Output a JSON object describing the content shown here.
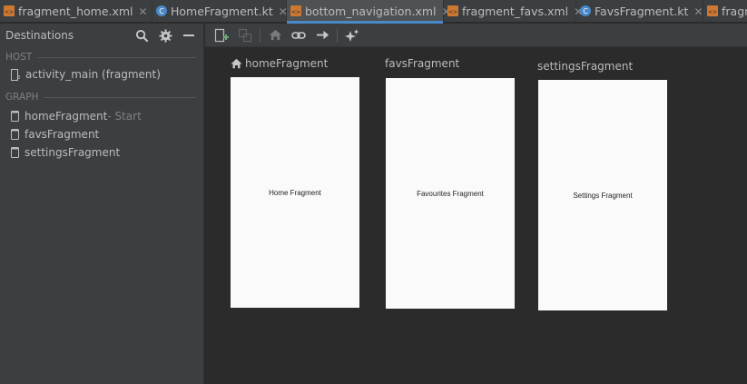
{
  "tabs": [
    {
      "label": "fragment_home.xml",
      "icon": "xml-file-icon",
      "active": false
    },
    {
      "label": "HomeFragment.kt",
      "icon": "kotlin-file-icon",
      "active": false
    },
    {
      "label": "bottom_navigation.xml",
      "icon": "xml-file-icon",
      "active": true
    },
    {
      "label": "fragment_favs.xml",
      "icon": "xml-file-icon",
      "active": false
    },
    {
      "label": "FavsFragment.kt",
      "icon": "kotlin-file-icon",
      "active": false
    },
    {
      "label": "fragn",
      "icon": "xml-file-icon",
      "active": false
    }
  ],
  "close_glyph": "✕",
  "sidebar": {
    "title": "Destinations",
    "host_section": "HOST",
    "host_item": "activity_main (fragment)",
    "graph_section": "GRAPH",
    "items": [
      {
        "label": "homeFragment",
        "suffix": " - Start"
      },
      {
        "label": "favsFragment",
        "suffix": ""
      },
      {
        "label": "settingsFragment",
        "suffix": ""
      }
    ]
  },
  "canvas": {
    "nodes": [
      {
        "title": "homeFragment",
        "content": "Home Fragment",
        "is_start": true
      },
      {
        "title": "favsFragment",
        "content": "Favourites Fragment",
        "is_start": false
      },
      {
        "title": "settingsFragment",
        "content": "Settings Fragment",
        "is_start": false
      }
    ]
  },
  "colors": {
    "accent": "#4a88c7",
    "xml_icon": "#cc7832",
    "kotlin_icon": "#4a88c7",
    "add_icon": "#6aab73"
  }
}
